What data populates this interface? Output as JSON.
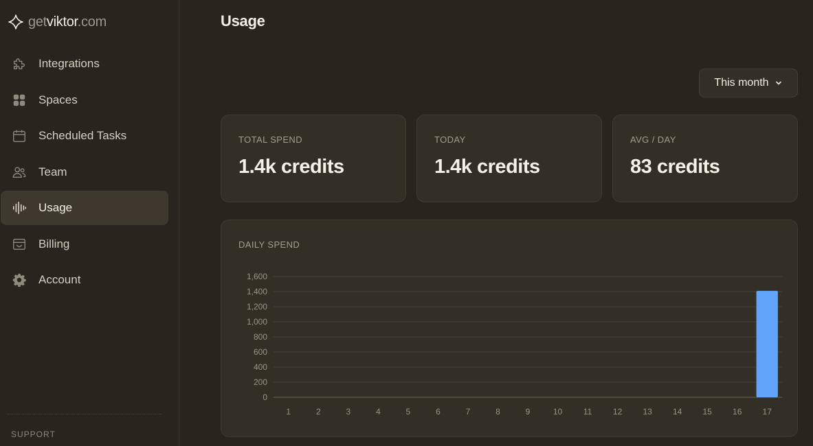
{
  "brand": {
    "part1": "get",
    "part2": "viktor",
    "part3": ".com"
  },
  "sidebar": {
    "items": [
      {
        "label": "Integrations",
        "icon": "puzzle-icon"
      },
      {
        "label": "Spaces",
        "icon": "grid-icon"
      },
      {
        "label": "Scheduled Tasks",
        "icon": "calendar-icon"
      },
      {
        "label": "Team",
        "icon": "users-icon"
      },
      {
        "label": "Usage",
        "icon": "waveform-icon",
        "active": true
      },
      {
        "label": "Billing",
        "icon": "wallet-icon"
      },
      {
        "label": "Account",
        "icon": "gear-icon"
      }
    ],
    "support_label": "SUPPORT"
  },
  "page": {
    "title": "Usage"
  },
  "filter": {
    "selected": "This month"
  },
  "cards": [
    {
      "label": "TOTAL SPEND",
      "value": "1.4k credits"
    },
    {
      "label": "TODAY",
      "value": "1.4k credits"
    },
    {
      "label": "AVG / DAY",
      "value": "83 credits"
    }
  ],
  "colors": {
    "accent": "#60a5fa",
    "background": "#29241d",
    "card": "#332e26"
  },
  "chart_data": {
    "type": "bar",
    "title": "DAILY SPEND",
    "categories": [
      "1",
      "2",
      "3",
      "4",
      "5",
      "6",
      "7",
      "8",
      "9",
      "10",
      "11",
      "12",
      "13",
      "14",
      "15",
      "16",
      "17"
    ],
    "values": [
      0,
      0,
      0,
      0,
      0,
      0,
      0,
      0,
      0,
      0,
      0,
      0,
      0,
      0,
      0,
      0,
      1410
    ],
    "yticks": [
      0,
      200,
      400,
      600,
      800,
      1000,
      1200,
      1400,
      1600
    ],
    "ytick_labels": [
      "0",
      "200",
      "400",
      "600",
      "800",
      "1,000",
      "1,200",
      "1,400",
      "1,600"
    ],
    "ylim": [
      0,
      1600
    ],
    "grid": true,
    "color": "#60a5fa"
  }
}
